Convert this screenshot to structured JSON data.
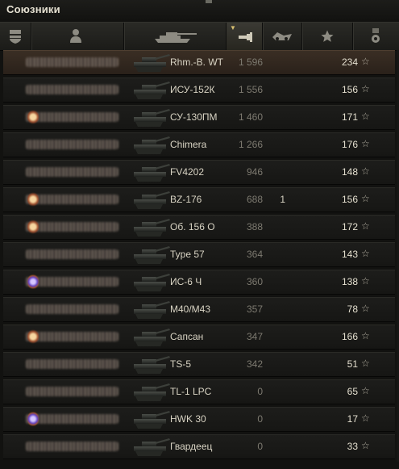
{
  "panel": {
    "title": "Союзники"
  },
  "header": {
    "columns": [
      {
        "icon": "shield-icon"
      },
      {
        "icon": "player-icon"
      },
      {
        "icon": "tank-icon"
      },
      {
        "icon": "damage-icon"
      },
      {
        "icon": "kills-icon"
      },
      {
        "icon": "star-icon"
      },
      {
        "icon": "medal-icon"
      }
    ],
    "sort_column": "damage-icon"
  },
  "rows": [
    {
      "vehicle": "Rhm.-B. WT",
      "damage": "1 596",
      "kills": "",
      "xp": "234",
      "star": "☆",
      "medal": "none",
      "highlight": true
    },
    {
      "vehicle": "ИСУ-152К",
      "damage": "1 556",
      "kills": "",
      "xp": "156",
      "star": "☆",
      "medal": "none",
      "highlight": false
    },
    {
      "vehicle": "СУ-130ПМ",
      "damage": "1 460",
      "kills": "",
      "xp": "171",
      "star": "☆",
      "medal": "orange",
      "highlight": false
    },
    {
      "vehicle": "Chimera",
      "damage": "1 266",
      "kills": "",
      "xp": "176",
      "star": "☆",
      "medal": "none",
      "highlight": false
    },
    {
      "vehicle": "FV4202",
      "damage": "946",
      "kills": "",
      "xp": "148",
      "star": "☆",
      "medal": "none",
      "highlight": false
    },
    {
      "vehicle": "BZ-176",
      "damage": "688",
      "kills": "1",
      "xp": "156",
      "star": "☆",
      "medal": "orange",
      "highlight": false
    },
    {
      "vehicle": "Об. 156 О",
      "damage": "388",
      "kills": "",
      "xp": "172",
      "star": "☆",
      "medal": "orange",
      "highlight": false
    },
    {
      "vehicle": "Type 57",
      "damage": "364",
      "kills": "",
      "xp": "143",
      "star": "☆",
      "medal": "none",
      "highlight": false
    },
    {
      "vehicle": "ИС-6 Ч",
      "damage": "360",
      "kills": "",
      "xp": "138",
      "star": "☆",
      "medal": "blue",
      "highlight": false
    },
    {
      "vehicle": "M40/M43",
      "damage": "357",
      "kills": "",
      "xp": "78",
      "star": "☆",
      "medal": "none",
      "highlight": false
    },
    {
      "vehicle": "Сапсан",
      "damage": "347",
      "kills": "",
      "xp": "166",
      "star": "☆",
      "medal": "orange",
      "highlight": false
    },
    {
      "vehicle": "TS-5",
      "damage": "342",
      "kills": "",
      "xp": "51",
      "star": "☆",
      "medal": "none",
      "highlight": false
    },
    {
      "vehicle": "TL-1 LPC",
      "damage": "0",
      "kills": "",
      "xp": "65",
      "star": "☆",
      "medal": "none",
      "highlight": false
    },
    {
      "vehicle": "HWK 30",
      "damage": "0",
      "kills": "",
      "xp": "17",
      "star": "☆",
      "medal": "blue",
      "highlight": false
    },
    {
      "vehicle": "Гвардеец",
      "damage": "0",
      "kills": "",
      "xp": "33",
      "star": "☆",
      "medal": "none",
      "highlight": false
    }
  ]
}
